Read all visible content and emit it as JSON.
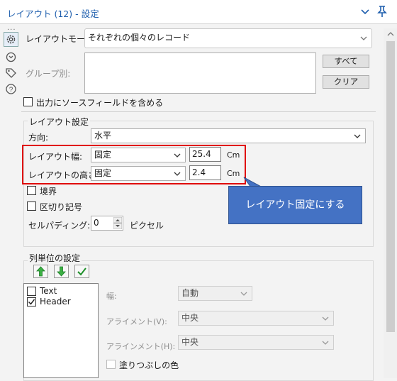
{
  "window": {
    "title": "レイアウト (12) - 設定",
    "title_color": "#1f5fae"
  },
  "rail": {
    "dots": "..."
  },
  "layout_mode": {
    "label": "レイアウトモード:",
    "value": "それぞれの個々のレコード"
  },
  "group_by": {
    "label": "グループ別:",
    "all_button": "すべて",
    "clear_button": "クリア"
  },
  "include_source": {
    "label": "出力にソースフィールドを含める",
    "checked": false
  },
  "layout_settings": {
    "title": "レイアウト設定",
    "direction_label": "方向:",
    "direction_value": "水平",
    "width_label": "レイアウト幅:",
    "width_mode": "固定",
    "width_value": "25.4",
    "width_unit": "Cm",
    "height_label": "レイアウトの高さ:",
    "height_mode": "固定",
    "height_value": "2.4",
    "height_unit": "Cm",
    "border_label": "境界",
    "border_checked": false,
    "separator_label": "区切り記号",
    "separator_checked": false,
    "padding_label": "セルパディング:",
    "padding_value": "0",
    "padding_unit": "ピクセル"
  },
  "annotation": {
    "text": "レイアウト固定にする",
    "box_color": "#e00000",
    "callout_color": "#4472c4"
  },
  "column_settings": {
    "title": "列単位の設定",
    "fields": [
      {
        "name": "Text",
        "checked": false
      },
      {
        "name": "Header",
        "checked": true
      }
    ],
    "width_label": "幅:",
    "width_value": "自動",
    "align_v_label": "アライメント(V):",
    "align_v_value": "中央",
    "align_h_label": "アラインメント(H):",
    "align_h_value": "中央",
    "fill_color_label": "塗りつぶしの色"
  }
}
